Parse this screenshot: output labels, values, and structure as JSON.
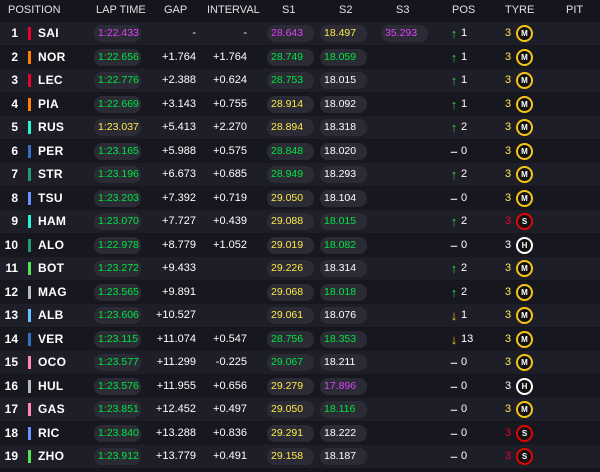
{
  "header": {
    "position": "POSITION",
    "lap_time": "LAP TIME",
    "gap": "GAP",
    "interval": "INTERVAL",
    "s1": "S1",
    "s2": "S2",
    "s3": "S3",
    "pos": "POS",
    "tyre": "TYRE",
    "pit": "PIT"
  },
  "colors": {
    "green": "#00e640",
    "purple": "#e040fb",
    "yellow": "#ffe94a",
    "white": "#ffffff",
    "red": "#e8002d",
    "medium": "#f5c518",
    "soft": "#e10600",
    "hard": "#ffffff"
  },
  "rows": [
    {
      "pos": "1",
      "driver": "SAI",
      "team_color": "#e8002d",
      "lap": "1:22.433",
      "lap_color": "purple",
      "gap": "-",
      "interval": "-",
      "s1": "28.643",
      "s1_color": "purple",
      "s2": "18.497",
      "s2_color": "yellow",
      "s3": "35.293",
      "s3_color": "purple",
      "arrow": "up",
      "change": "1",
      "tyre_age": "3",
      "tyre_age_color": "yellow",
      "tyre": "M",
      "tyre_color": "medium"
    },
    {
      "pos": "2",
      "driver": "NOR",
      "team_color": "#ff8000",
      "lap": "1:22.656",
      "lap_color": "green",
      "gap": "+1.764",
      "interval": "+1.764",
      "s1": "28.749",
      "s1_color": "green",
      "s2": "18.059",
      "s2_color": "green",
      "s3": "",
      "s3_color": "white",
      "arrow": "up",
      "change": "1",
      "tyre_age": "3",
      "tyre_age_color": "yellow",
      "tyre": "M",
      "tyre_color": "medium"
    },
    {
      "pos": "3",
      "driver": "LEC",
      "team_color": "#e8002d",
      "lap": "1:22.776",
      "lap_color": "green",
      "gap": "+2.388",
      "interval": "+0.624",
      "s1": "28.753",
      "s1_color": "green",
      "s2": "18.015",
      "s2_color": "white",
      "s3": "",
      "s3_color": "white",
      "arrow": "up",
      "change": "1",
      "tyre_age": "3",
      "tyre_age_color": "yellow",
      "tyre": "M",
      "tyre_color": "medium"
    },
    {
      "pos": "4",
      "driver": "PIA",
      "team_color": "#ff8000",
      "lap": "1:22.669",
      "lap_color": "green",
      "gap": "+3.143",
      "interval": "+0.755",
      "s1": "28.914",
      "s1_color": "yellow",
      "s2": "18.092",
      "s2_color": "white",
      "s3": "",
      "s3_color": "white",
      "arrow": "up",
      "change": "1",
      "tyre_age": "3",
      "tyre_age_color": "yellow",
      "tyre": "M",
      "tyre_color": "medium"
    },
    {
      "pos": "5",
      "driver": "RUS",
      "team_color": "#27f4d2",
      "lap": "1:23.037",
      "lap_color": "yellow",
      "gap": "+5.413",
      "interval": "+2.270",
      "s1": "28.894",
      "s1_color": "yellow",
      "s2": "18.318",
      "s2_color": "white",
      "s3": "",
      "s3_color": "white",
      "arrow": "up",
      "change": "2",
      "tyre_age": "3",
      "tyre_age_color": "yellow",
      "tyre": "M",
      "tyre_color": "medium"
    },
    {
      "pos": "6",
      "driver": "PER",
      "team_color": "#3671c6",
      "lap": "1:23.165",
      "lap_color": "green",
      "gap": "+5.988",
      "interval": "+0.575",
      "s1": "28.848",
      "s1_color": "green",
      "s2": "18.020",
      "s2_color": "white",
      "s3": "",
      "s3_color": "white",
      "arrow": "dash",
      "change": "0",
      "tyre_age": "3",
      "tyre_age_color": "yellow",
      "tyre": "M",
      "tyre_color": "medium"
    },
    {
      "pos": "7",
      "driver": "STR",
      "team_color": "#229971",
      "lap": "1:23.196",
      "lap_color": "green",
      "gap": "+6.673",
      "interval": "+0.685",
      "s1": "28.949",
      "s1_color": "green",
      "s2": "18.293",
      "s2_color": "white",
      "s3": "",
      "s3_color": "white",
      "arrow": "up",
      "change": "2",
      "tyre_age": "3",
      "tyre_age_color": "yellow",
      "tyre": "M",
      "tyre_color": "medium"
    },
    {
      "pos": "8",
      "driver": "TSU",
      "team_color": "#6692ff",
      "lap": "1:23.203",
      "lap_color": "green",
      "gap": "+7.392",
      "interval": "+0.719",
      "s1": "29.050",
      "s1_color": "yellow",
      "s2": "18.104",
      "s2_color": "white",
      "s3": "",
      "s3_color": "white",
      "arrow": "dash",
      "change": "0",
      "tyre_age": "3",
      "tyre_age_color": "yellow",
      "tyre": "M",
      "tyre_color": "medium"
    },
    {
      "pos": "9",
      "driver": "HAM",
      "team_color": "#27f4d2",
      "lap": "1:23.070",
      "lap_color": "green",
      "gap": "+7.727",
      "interval": "+0.439",
      "s1": "29.088",
      "s1_color": "yellow",
      "s2": "18.015",
      "s2_color": "green",
      "s3": "",
      "s3_color": "white",
      "arrow": "up",
      "change": "2",
      "tyre_age": "3",
      "tyre_age_color": "red",
      "tyre": "S",
      "tyre_color": "soft"
    },
    {
      "pos": "10",
      "driver": "ALO",
      "team_color": "#229971",
      "lap": "1:22.978",
      "lap_color": "green",
      "gap": "+8.779",
      "interval": "+1.052",
      "s1": "29.019",
      "s1_color": "yellow",
      "s2": "18.082",
      "s2_color": "green",
      "s3": "",
      "s3_color": "white",
      "arrow": "dash",
      "change": "0",
      "tyre_age": "3",
      "tyre_age_color": "white",
      "tyre": "H",
      "tyre_color": "hard"
    },
    {
      "pos": "11",
      "driver": "BOT",
      "team_color": "#52e252",
      "lap": "1:23.272",
      "lap_color": "green",
      "gap": "+9.433",
      "interval": "",
      "s1": "29.226",
      "s1_color": "yellow",
      "s2": "18.314",
      "s2_color": "white",
      "s3": "",
      "s3_color": "white",
      "arrow": "up",
      "change": "2",
      "tyre_age": "3",
      "tyre_age_color": "yellow",
      "tyre": "M",
      "tyre_color": "medium"
    },
    {
      "pos": "12",
      "driver": "MAG",
      "team_color": "#b6babd",
      "lap": "1:23.565",
      "lap_color": "green",
      "gap": "+9.891",
      "interval": "",
      "s1": "29.068",
      "s1_color": "yellow",
      "s2": "18.018",
      "s2_color": "green",
      "s3": "",
      "s3_color": "white",
      "arrow": "up",
      "change": "2",
      "tyre_age": "3",
      "tyre_age_color": "yellow",
      "tyre": "M",
      "tyre_color": "medium"
    },
    {
      "pos": "13",
      "driver": "ALB",
      "team_color": "#64c4ff",
      "lap": "1:23.606",
      "lap_color": "green",
      "gap": "+10.527",
      "interval": "",
      "s1": "29.061",
      "s1_color": "yellow",
      "s2": "18.076",
      "s2_color": "white",
      "s3": "",
      "s3_color": "white",
      "arrow": "down",
      "change": "1",
      "tyre_age": "3",
      "tyre_age_color": "yellow",
      "tyre": "M",
      "tyre_color": "medium"
    },
    {
      "pos": "14",
      "driver": "VER",
      "team_color": "#3671c6",
      "lap": "1:23.115",
      "lap_color": "green",
      "gap": "+11.074",
      "interval": "+0.547",
      "s1": "28.756",
      "s1_color": "green",
      "s2": "18.353",
      "s2_color": "green",
      "s3": "",
      "s3_color": "white",
      "arrow": "down",
      "change": "13",
      "tyre_age": "3",
      "tyre_age_color": "yellow",
      "tyre": "M",
      "tyre_color": "medium"
    },
    {
      "pos": "15",
      "driver": "OCO",
      "team_color": "#ff87bc",
      "lap": "1:23.577",
      "lap_color": "green",
      "gap": "+11.299",
      "interval": "-0.225",
      "s1": "29.067",
      "s1_color": "green",
      "s2": "18.211",
      "s2_color": "white",
      "s3": "",
      "s3_color": "white",
      "arrow": "dash",
      "change": "0",
      "tyre_age": "3",
      "tyre_age_color": "yellow",
      "tyre": "M",
      "tyre_color": "medium"
    },
    {
      "pos": "16",
      "driver": "HUL",
      "team_color": "#b6babd",
      "lap": "1:23.576",
      "lap_color": "green",
      "gap": "+11.955",
      "interval": "+0.656",
      "s1": "29.279",
      "s1_color": "yellow",
      "s2": "17.896",
      "s2_color": "purple",
      "s3": "",
      "s3_color": "white",
      "arrow": "dash",
      "change": "0",
      "tyre_age": "3",
      "tyre_age_color": "white",
      "tyre": "H",
      "tyre_color": "hard"
    },
    {
      "pos": "17",
      "driver": "GAS",
      "team_color": "#ff87bc",
      "lap": "1:23.851",
      "lap_color": "green",
      "gap": "+12.452",
      "interval": "+0.497",
      "s1": "29.050",
      "s1_color": "yellow",
      "s2": "18.116",
      "s2_color": "green",
      "s3": "",
      "s3_color": "white",
      "arrow": "dash",
      "change": "0",
      "tyre_age": "3",
      "tyre_age_color": "yellow",
      "tyre": "M",
      "tyre_color": "medium"
    },
    {
      "pos": "18",
      "driver": "RIC",
      "team_color": "#6692ff",
      "lap": "1:23.840",
      "lap_color": "green",
      "gap": "+13.288",
      "interval": "+0.836",
      "s1": "29.291",
      "s1_color": "yellow",
      "s2": "18.222",
      "s2_color": "white",
      "s3": "",
      "s3_color": "white",
      "arrow": "dash",
      "change": "0",
      "tyre_age": "3",
      "tyre_age_color": "red",
      "tyre": "S",
      "tyre_color": "soft"
    },
    {
      "pos": "19",
      "driver": "ZHO",
      "team_color": "#52e252",
      "lap": "1:23.912",
      "lap_color": "green",
      "gap": "+13.779",
      "interval": "+0.491",
      "s1": "29.158",
      "s1_color": "yellow",
      "s2": "18.187",
      "s2_color": "white",
      "s3": "",
      "s3_color": "white",
      "arrow": "dash",
      "change": "0",
      "tyre_age": "3",
      "tyre_age_color": "red",
      "tyre": "S",
      "tyre_color": "soft"
    }
  ]
}
